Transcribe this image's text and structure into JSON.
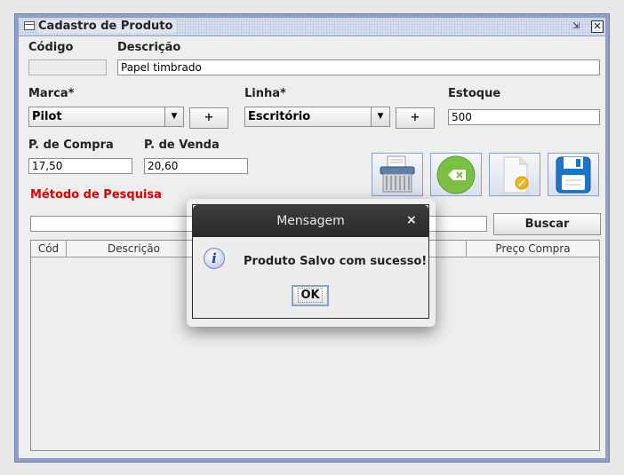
{
  "window": {
    "title": "Cadastro de Produto",
    "restore_glyph": "⇲",
    "close_glyph": "✕"
  },
  "form": {
    "codigo_label": "Código",
    "codigo_value": "",
    "descricao_label": "Descrição",
    "descricao_value": "Papel timbrado",
    "marca_label": "Marca*",
    "marca_value": "Pilot",
    "marca_add": "+",
    "linha_label": "Linha*",
    "linha_value": "Escritório",
    "linha_add": "+",
    "estoque_label": "Estoque",
    "estoque_value": "500",
    "p_compra_label": "P. de Compra",
    "p_compra_value": "17,50",
    "p_venda_label": "P. de Venda",
    "p_venda_value": "20,60"
  },
  "toolbar": {
    "icons": [
      "shredder-icon",
      "clear-icon",
      "edit-document-icon",
      "save-floppy-icon"
    ]
  },
  "search": {
    "label": "Método de Pesquisa",
    "value": "",
    "button": "Buscar"
  },
  "table": {
    "columns": [
      "Cód",
      "Descrição",
      "Preço Compra"
    ]
  },
  "dialog": {
    "title": "Mensagem",
    "close_glyph": "×",
    "info_glyph": "i",
    "message": "Produto Salvo com sucesso!",
    "ok": "OK"
  },
  "colors": {
    "frame": "#8ea0c4",
    "required_red": "#e00000",
    "dialog_header": "#2f2f2f",
    "save_blue": "#1d74c9",
    "clear_green": "#7bc043"
  }
}
